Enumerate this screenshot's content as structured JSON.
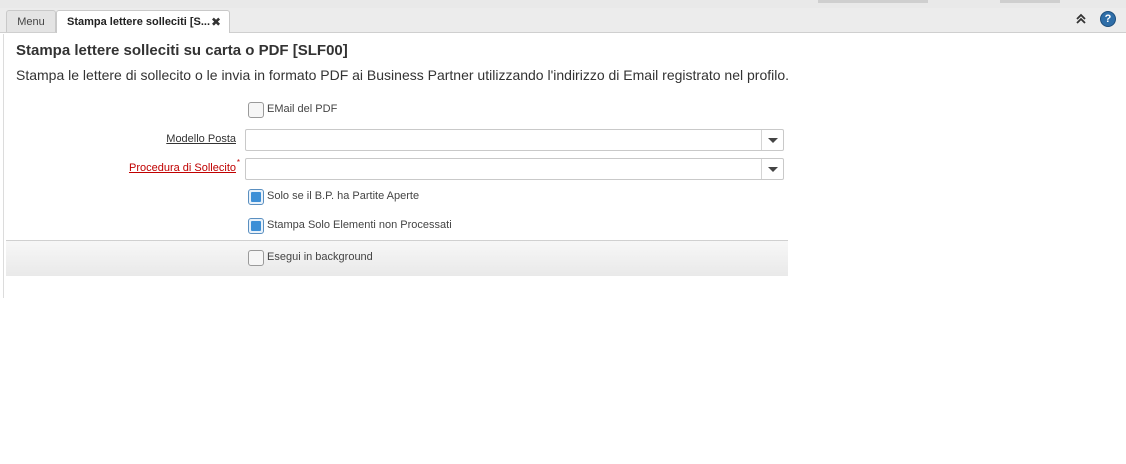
{
  "tabs": {
    "menu_label": "Menu",
    "active_label": "Stampa lettere solleciti [S...",
    "close_glyph": "✖"
  },
  "toolbar": {
    "collapse_glyph": "⌃",
    "help_glyph": "?"
  },
  "page": {
    "title": "Stampa lettere solleciti su carta o PDF [SLF00]",
    "description": "Stampa le lettere di sollecito o le invia in formato PDF ai Business Partner utilizzando l'indirizzo di Email registrato nel profilo."
  },
  "form": {
    "email_pdf": {
      "label": "EMail del PDF",
      "checked": false
    },
    "mail_template": {
      "label": "Modello Posta",
      "value": ""
    },
    "dunning": {
      "label": "Procedura di Sollecito",
      "mandatory_mark": "*",
      "value": ""
    },
    "only_open": {
      "label": "Solo se il B.P. ha Partite Aperte",
      "checked": true
    },
    "only_unprocessed": {
      "label": "Stampa Solo Elementi non Processati",
      "checked": true
    },
    "background": {
      "label": "Esegui in background",
      "checked": false
    }
  },
  "colors": {
    "accent": "#3d8fd6",
    "mandatory": "#c00000",
    "help": "#2f6ea8"
  }
}
